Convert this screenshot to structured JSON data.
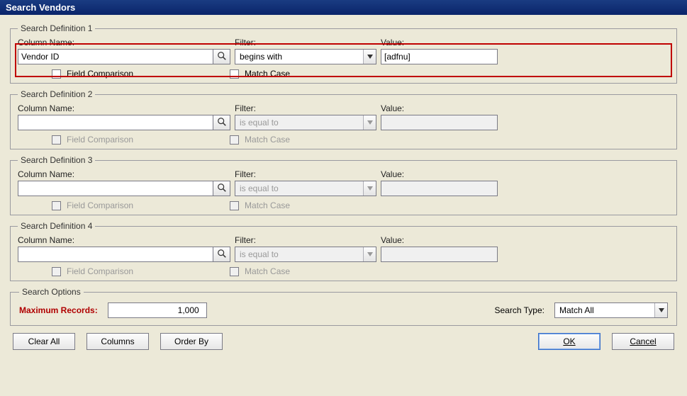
{
  "window": {
    "title": "Search Vendors"
  },
  "labels": {
    "column_name": "Column Name:",
    "filter": "Filter:",
    "value": "Value:",
    "field_comparison": "Field Comparison",
    "match_case": "Match Case"
  },
  "definitions": [
    {
      "legend": "Search Definition 1",
      "enabled": true,
      "highlight": true,
      "column_name": "Vendor ID",
      "filter": "begins with",
      "value": "[adfnu]",
      "field_comparison": false,
      "match_case": false
    },
    {
      "legend": "Search Definition 2",
      "enabled": false,
      "highlight": false,
      "column_name": "",
      "filter": "is equal to",
      "value": "",
      "field_comparison": false,
      "match_case": false
    },
    {
      "legend": "Search Definition 3",
      "enabled": false,
      "highlight": false,
      "column_name": "",
      "filter": "is equal to",
      "value": "",
      "field_comparison": false,
      "match_case": false
    },
    {
      "legend": "Search Definition 4",
      "enabled": false,
      "highlight": false,
      "column_name": "",
      "filter": "is equal to",
      "value": "",
      "field_comparison": false,
      "match_case": false
    }
  ],
  "options": {
    "legend": "Search Options",
    "max_records_label": "Maximum Records:",
    "max_records_value": "1,000",
    "search_type_label": "Search Type:",
    "search_type_value": "Match All"
  },
  "buttons": {
    "clear_all": "Clear All",
    "columns": "Columns",
    "order_by": "Order By",
    "ok": "OK",
    "cancel": "Cancel"
  },
  "icons": {
    "lookup": "magnifier",
    "dropdown": "triangle-down"
  }
}
